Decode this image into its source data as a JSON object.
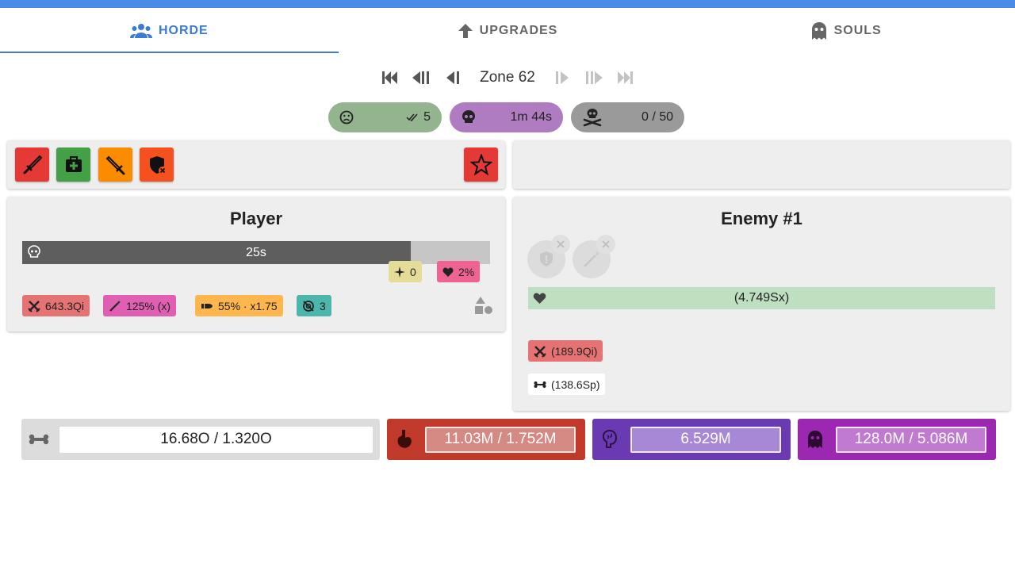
{
  "tabs": [
    {
      "label": "HORDE",
      "icon": "group-icon",
      "active": true
    },
    {
      "label": "UPGRADES",
      "icon": "arrow-up-icon",
      "active": false
    },
    {
      "label": "SOULS",
      "icon": "ghost-icon",
      "active": false
    }
  ],
  "zone": {
    "label": "Zone 62"
  },
  "pills": {
    "green": {
      "value": "5",
      "icon": "sad-face-icon",
      "check_icon": "double-check-icon",
      "color": "#93b48f"
    },
    "purple": {
      "value": "1m 44s",
      "icon": "skull-icon",
      "color": "#b07cc1"
    },
    "gray": {
      "value": "0 / 50",
      "icon": "skull-crossbones-icon",
      "color": "#9a9a9a"
    }
  },
  "actions": [
    {
      "icon": "sword-icon",
      "color": "#e53935"
    },
    {
      "icon": "medkit-icon",
      "color": "#43a047"
    },
    {
      "icon": "blade-icon",
      "color": "#fb8c00"
    },
    {
      "icon": "shield-x-icon",
      "color": "#f4511e"
    },
    {
      "icon": "star-icon",
      "color": "#e53935"
    }
  ],
  "player": {
    "title": "Player",
    "timer": "25s",
    "timer_progress": 0.83,
    "small_tags": {
      "sparkle": "0",
      "heart": "2%"
    },
    "stats": {
      "damage": "643.3Qi",
      "crit": "125% (x)",
      "bullet": "55% · x1.75",
      "target": "3"
    }
  },
  "enemy": {
    "title": "Enemy #1",
    "health": "(4.749Sx)",
    "damage": "(189.9Qi)",
    "bone": "(138.6Sp)"
  },
  "resources": {
    "bones": {
      "value": "16.68O / 1.320O",
      "icon": "bone-icon"
    },
    "blood": {
      "value": "11.03M / 1.752M",
      "icon": "stomach-icon",
      "color": "#c0392b"
    },
    "brains": {
      "value": "6.529M",
      "icon": "brain-icon",
      "color": "#6a3ab2"
    },
    "souls": {
      "value": "128.0M / 5.086M",
      "icon": "ghost-icon",
      "color": "#9c27b0"
    }
  }
}
